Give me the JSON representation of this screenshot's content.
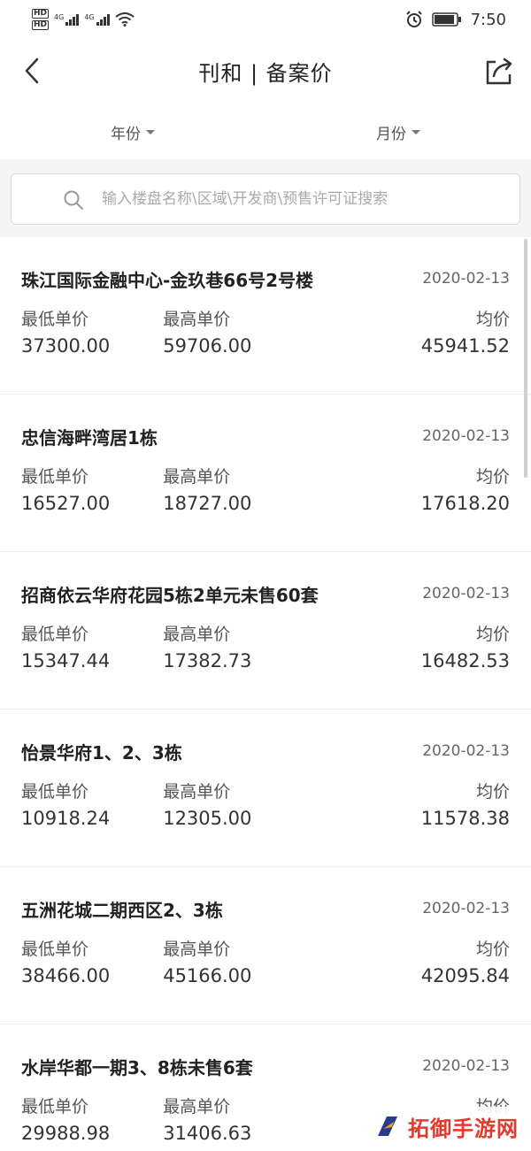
{
  "status_bar": {
    "hd1": "HD",
    "hd2": "HD",
    "net1": "4G",
    "net2": "4G",
    "time": "7:50",
    "icons": [
      "alarm-icon",
      "battery-icon",
      "wifi-icon",
      "signal-icon"
    ]
  },
  "nav": {
    "title": "刊和 | 备案价",
    "icons": [
      "back-chevron-icon",
      "share-icon"
    ]
  },
  "filters": {
    "year_label": "年份",
    "month_label": "月份"
  },
  "search": {
    "placeholder": "输入楼盘名称\\区域\\开发商\\预售许可证搜索"
  },
  "list": {
    "col_min_label": "最低单价",
    "col_max_label": "最高单价",
    "col_avg_label": "均价",
    "items": [
      {
        "name": "珠江国际金融中心-金玖巷66号2号楼",
        "date": "2020-02-13",
        "min": "37300.00",
        "max": "59706.00",
        "avg": "45941.52"
      },
      {
        "name": "忠信海畔湾居1栋",
        "date": "2020-02-13",
        "min": "16527.00",
        "max": "18727.00",
        "avg": "17618.20"
      },
      {
        "name": "招商依云华府花园5栋2单元未售60套",
        "date": "2020-02-13",
        "min": "15347.44",
        "max": "17382.73",
        "avg": "16482.53"
      },
      {
        "name": "怡景华府1、2、3栋",
        "date": "2020-02-13",
        "min": "10918.24",
        "max": "12305.00",
        "avg": "11578.38"
      },
      {
        "name": "五洲花城二期西区2、3栋",
        "date": "2020-02-13",
        "min": "38466.00",
        "max": "45166.00",
        "avg": "42095.84"
      },
      {
        "name": "水岸华都一期3、8栋未售6套",
        "date": "2020-02-13",
        "min": "29988.98",
        "max": "31406.63",
        "avg": "均价"
      }
    ]
  },
  "watermark": {
    "text": "拓御手游网",
    "color": "#e23a2c"
  }
}
